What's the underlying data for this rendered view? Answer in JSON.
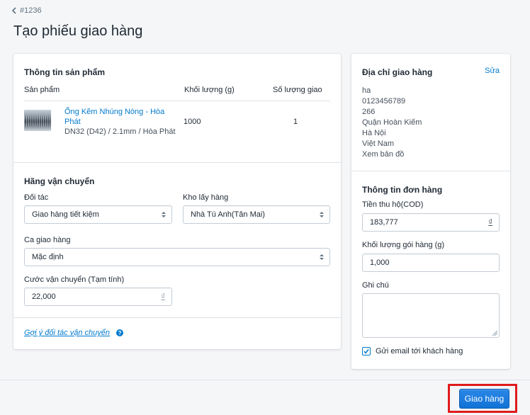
{
  "header": {
    "back_label": "#1236",
    "title": "Tạo phiếu giao hàng"
  },
  "product_section": {
    "title": "Thông tin sản phẩm",
    "columns": [
      "Sản phẩm",
      "Khối lượng (g)",
      "Số lượng giao"
    ],
    "items": [
      {
        "name_line1": "Ống Kẽm Nhúng Nóng - Hòa",
        "name_line2": "Phát",
        "variant": "DN32 (D42) / 2.1mm / Hòa Phát",
        "weight": "1000",
        "quantity": "1"
      }
    ]
  },
  "shipping_section": {
    "title": "Hãng vận chuyển",
    "partner_label": "Đối tác",
    "partner_value": "Giao hàng tiết kiệm",
    "warehouse_label": "Kho lấy hàng",
    "warehouse_value": "Nhà Tú Anh(Tân Mai)",
    "shift_label": "Ca giao hàng",
    "shift_value": "Mặc định",
    "fee_label": "Cước vận chuyển (Tạm tính)",
    "fee_value": "22,000",
    "currency": "₫"
  },
  "suggest_link": "Gợi ý đối tác vận chuyển",
  "address_section": {
    "title": "Địa chỉ giao hàng",
    "edit_label": "Sửa",
    "lines": [
      "ha",
      "0123456789",
      "266",
      "Quận Hoàn Kiếm",
      "Hà Nội",
      "Việt Nam"
    ],
    "map_link": "Xem bản đồ"
  },
  "order_section": {
    "title": "Thông tin đơn hàng",
    "cod_label": "Tiền thu hộ(COD)",
    "cod_value": "183,777",
    "currency": "₫",
    "package_weight_label": "Khối lượng gói hàng (g)",
    "package_weight_value": "1,000",
    "note_label": "Ghi chú",
    "note_value": "",
    "email_label": "Gửi email tới khách hàng",
    "email_checked": true
  },
  "footer": {
    "submit_label": "Giao hàng"
  },
  "colors": {
    "accent": "#007ace",
    "primary_button": "#1172d6",
    "highlight": "#e01b1b"
  }
}
